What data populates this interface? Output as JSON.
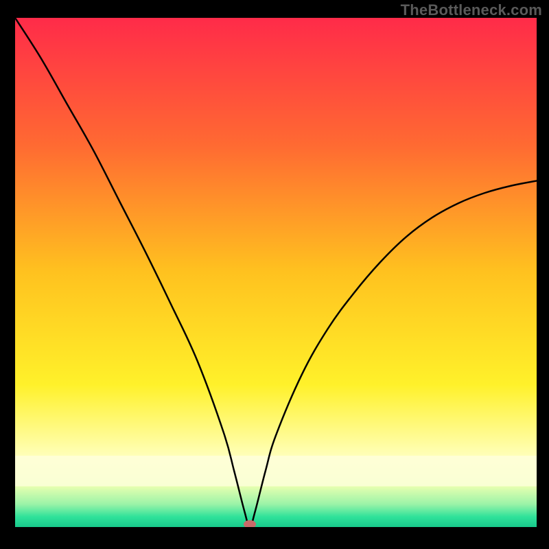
{
  "watermark": "TheBottleneck.com",
  "chart_data": {
    "type": "line",
    "title": "",
    "xlabel": "",
    "ylabel": "",
    "xlim": [
      0,
      100
    ],
    "ylim": [
      0,
      100
    ],
    "grid": false,
    "legend": false,
    "series": [
      {
        "name": "bottleneck-curve",
        "x": [
          0,
          5,
          10,
          15,
          20,
          25,
          30,
          35,
          40,
          42,
          44,
          45,
          46,
          48,
          50,
          55,
          60,
          65,
          70,
          75,
          80,
          85,
          90,
          95,
          100
        ],
        "values": [
          100,
          92,
          83,
          74,
          64,
          54,
          43.5,
          32.5,
          18.5,
          11,
          3,
          0,
          3,
          11,
          18,
          30,
          39,
          46,
          52,
          57,
          60.8,
          63.6,
          65.6,
          67,
          68
        ]
      }
    ],
    "marker": {
      "x": 45,
      "y": 0,
      "color": "#c96a6a"
    },
    "background_gradient": {
      "type": "vertical",
      "stops": [
        {
          "offset": 0.0,
          "color": "#ff2b49"
        },
        {
          "offset": 0.25,
          "color": "#ff6a32"
        },
        {
          "offset": 0.5,
          "color": "#ffc21f"
        },
        {
          "offset": 0.72,
          "color": "#fff12a"
        },
        {
          "offset": 0.86,
          "color": "#ffffb8"
        },
        {
          "offset": 0.92,
          "color": "#e6ffb0"
        },
        {
          "offset": 0.955,
          "color": "#9bf3a8"
        },
        {
          "offset": 0.98,
          "color": "#2fe29a"
        },
        {
          "offset": 1.0,
          "color": "#18c98c"
        }
      ]
    }
  }
}
